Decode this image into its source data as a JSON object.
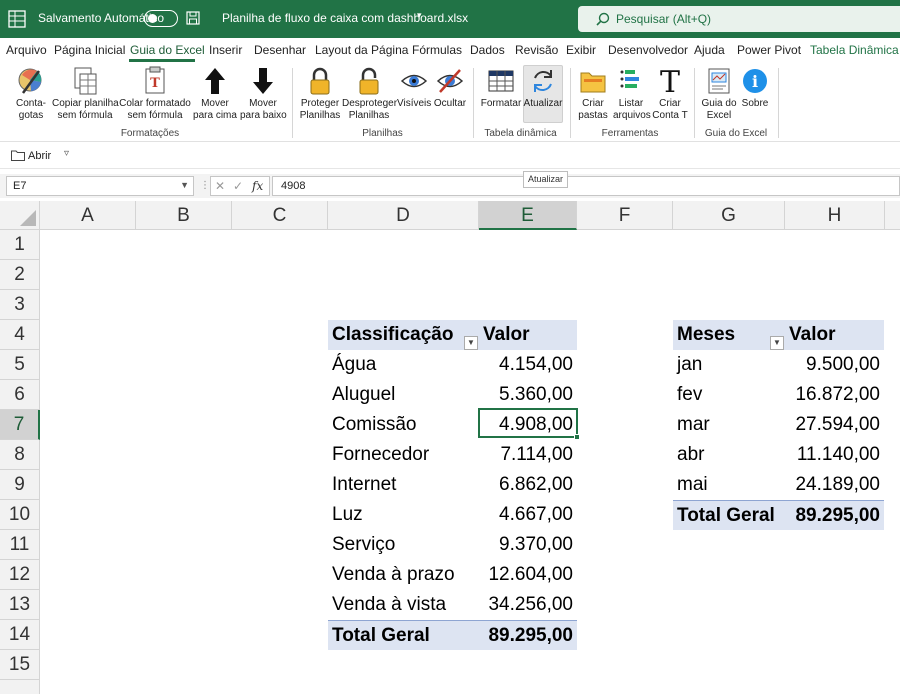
{
  "titlebar": {
    "autosave_label": "Salvamento Automático",
    "filename": "Planilha de fluxo de caixa com dashboard.xlsx",
    "search_placeholder": "Pesquisar (Alt+Q)"
  },
  "tabs": [
    "Arquivo",
    "Página Inicial",
    "Guia do Excel",
    "Inserir",
    "Desenhar",
    "Layout da Página",
    "Fórmulas",
    "Dados",
    "Revisão",
    "Exibir",
    "Desenvolvedor",
    "Ajuda",
    "Power Pivot",
    "Tabela Dinâmica Ana"
  ],
  "active_tab": "Guia do Excel",
  "ribbon": {
    "buttons": [
      {
        "label": "Conta-\ngotas",
        "icon": "eyedropper-icon"
      },
      {
        "label": "Copiar planilha\nsem fórmula",
        "icon": "copy-sheet-icon"
      },
      {
        "label": "Colar formatado\nsem fórmula",
        "icon": "paste-icon"
      },
      {
        "label": "Mover\npara cima",
        "icon": "arrow-up-icon"
      },
      {
        "label": "Mover\npara baixo",
        "icon": "arrow-down-icon"
      },
      {
        "label": "Proteger\nPlanilhas",
        "icon": "lock-icon"
      },
      {
        "label": "Desproteger\nPlanilhas",
        "icon": "unlock-icon"
      },
      {
        "label": "Visíveis",
        "icon": "eye-icon"
      },
      {
        "label": "Ocultar",
        "icon": "eye-off-icon"
      },
      {
        "label": "Formatar",
        "icon": "table-icon"
      },
      {
        "label": "Atualizar",
        "icon": "refresh-icon"
      },
      {
        "label": "Criar\npastas",
        "icon": "folder-icon"
      },
      {
        "label": "Listar\narquivos",
        "icon": "list-icon"
      },
      {
        "label": "Criar\nConta T",
        "icon": "t-icon"
      },
      {
        "label": "Guia do\nExcel",
        "icon": "excel-guide-icon"
      },
      {
        "label": "Sobre",
        "icon": "info-icon"
      }
    ],
    "groups": [
      "Formatações",
      "Planilhas",
      "Tabela dinâmica",
      "Ferramentas",
      "Guia do Excel"
    ]
  },
  "qat": {
    "open_label": "Abrir"
  },
  "tooltip": "Atualizar",
  "formula_bar": {
    "name_box": "E7",
    "formula": "4908",
    "fx": "fx"
  },
  "columns": [
    "A",
    "B",
    "C",
    "D",
    "E",
    "F",
    "G",
    "H"
  ],
  "rows": [
    "1",
    "2",
    "3",
    "4",
    "5",
    "6",
    "7",
    "8",
    "9",
    "10",
    "11",
    "12",
    "13",
    "14",
    "15"
  ],
  "selected_column": "E",
  "selected_row": "7",
  "pivot1": {
    "header_label": "Classificação",
    "header_value": "Valor",
    "rows": [
      {
        "label": "Água",
        "value": "4.154,00"
      },
      {
        "label": "Aluguel",
        "value": "5.360,00"
      },
      {
        "label": "Comissão",
        "value": "4.908,00"
      },
      {
        "label": "Fornecedor",
        "value": "7.114,00"
      },
      {
        "label": "Internet",
        "value": "6.862,00"
      },
      {
        "label": "Luz",
        "value": "4.667,00"
      },
      {
        "label": "Serviço",
        "value": "9.370,00"
      },
      {
        "label": "Venda à prazo",
        "value": "12.604,00"
      },
      {
        "label": "Venda à vista",
        "value": "34.256,00"
      }
    ],
    "total_label": "Total Geral",
    "total_value": "89.295,00"
  },
  "pivot2": {
    "header_label": "Meses",
    "header_value": "Valor",
    "rows": [
      {
        "label": "jan",
        "value": "9.500,00"
      },
      {
        "label": "fev",
        "value": "16.872,00"
      },
      {
        "label": "mar",
        "value": "27.594,00"
      },
      {
        "label": "abr",
        "value": "11.140,00"
      },
      {
        "label": "mai",
        "value": "24.189,00"
      }
    ],
    "total_label": "Total Geral",
    "total_value": "89.295,00"
  },
  "colors": {
    "excel_green": "#217346",
    "pivot_header": "#dde4f2"
  }
}
